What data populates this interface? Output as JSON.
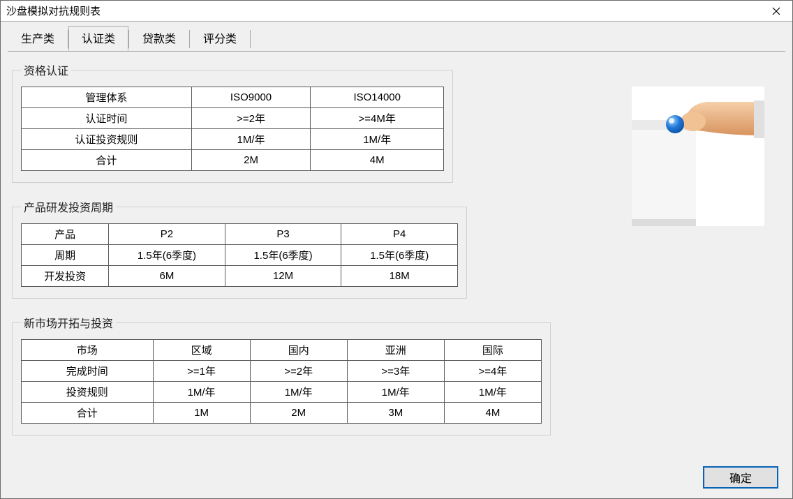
{
  "window": {
    "title": "沙盘模拟对抗规则表"
  },
  "tabs": [
    "生产类",
    "认证类",
    "贷款类",
    "评分类"
  ],
  "active_tab_index": 1,
  "group1": {
    "legend": "资格认证",
    "rows": [
      [
        "管理体系",
        "ISO9000",
        "ISO14000"
      ],
      [
        "认证时间",
        ">=2年",
        ">=4M年"
      ],
      [
        "认证投资规则",
        "1M/年",
        "1M/年"
      ],
      [
        "合计",
        "2M",
        "4M"
      ]
    ]
  },
  "group2": {
    "legend": "产品研发投资周期",
    "rows": [
      [
        "产品",
        "P2",
        "P3",
        "P4"
      ],
      [
        "周期",
        "1.5年(6季度)",
        "1.5年(6季度)",
        "1.5年(6季度)"
      ],
      [
        "开发投资",
        "6M",
        "12M",
        "18M"
      ]
    ]
  },
  "group3": {
    "legend": "新市场开拓与投资",
    "rows": [
      [
        "市场",
        "区域",
        "国内",
        "亚洲",
        "国际"
      ],
      [
        "完成时间",
        ">=1年",
        ">=2年",
        ">=3年",
        ">=4年"
      ],
      [
        "投资规则",
        "1M/年",
        "1M/年",
        "1M/年",
        "1M/年"
      ],
      [
        "合计",
        "1M",
        "2M",
        "3M",
        "4M"
      ]
    ]
  },
  "buttons": {
    "ok": "确定"
  }
}
